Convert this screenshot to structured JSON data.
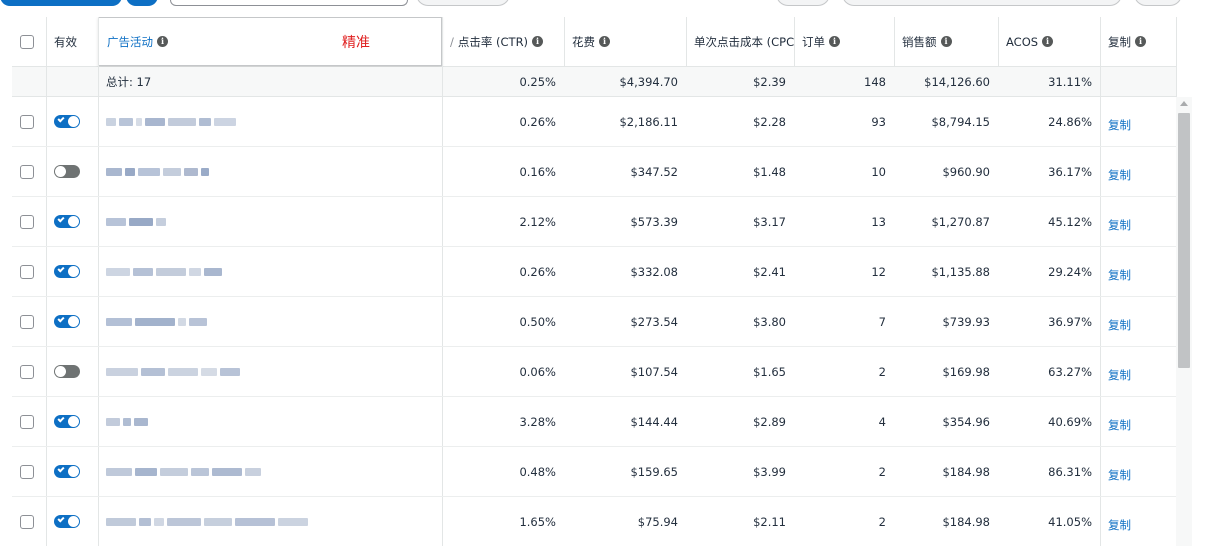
{
  "header": {
    "active": "有效",
    "campaign": "广告活动",
    "precise_tag": "精准",
    "ctr": "点击率 (CTR)",
    "ctr_prefix": "/",
    "spend": "花费",
    "cpc": "单次点击成本 (CPC)",
    "orders": "订单",
    "sales": "销售额",
    "acos": "ACOS",
    "copy": "复制"
  },
  "total": {
    "label": "总计: 17",
    "ctr": "0.25%",
    "spend": "$4,394.70",
    "cpc": "$2.39",
    "orders": "148",
    "sales": "$14,126.60",
    "acos": "31.11%"
  },
  "rows": [
    {
      "enabled": true,
      "ctr": "0.26%",
      "spend": "$2,186.11",
      "cpc": "$2.28",
      "orders": "93",
      "sales": "$8,794.15",
      "acos": "24.86%",
      "copy": "复制"
    },
    {
      "enabled": false,
      "ctr": "0.16%",
      "spend": "$347.52",
      "cpc": "$1.48",
      "orders": "10",
      "sales": "$960.90",
      "acos": "36.17%",
      "copy": "复制"
    },
    {
      "enabled": true,
      "ctr": "2.12%",
      "spend": "$573.39",
      "cpc": "$3.17",
      "orders": "13",
      "sales": "$1,270.87",
      "acos": "45.12%",
      "copy": "复制"
    },
    {
      "enabled": true,
      "ctr": "0.26%",
      "spend": "$332.08",
      "cpc": "$2.41",
      "orders": "12",
      "sales": "$1,135.88",
      "acos": "29.24%",
      "copy": "复制"
    },
    {
      "enabled": true,
      "ctr": "0.50%",
      "spend": "$273.54",
      "cpc": "$3.80",
      "orders": "7",
      "sales": "$739.93",
      "acos": "36.97%",
      "copy": "复制"
    },
    {
      "enabled": false,
      "ctr": "0.06%",
      "spend": "$107.54",
      "cpc": "$1.65",
      "orders": "2",
      "sales": "$169.98",
      "acos": "63.27%",
      "copy": "复制"
    },
    {
      "enabled": true,
      "ctr": "3.28%",
      "spend": "$144.44",
      "cpc": "$2.89",
      "orders": "4",
      "sales": "$354.96",
      "acos": "40.69%",
      "copy": "复制"
    },
    {
      "enabled": true,
      "ctr": "0.48%",
      "spend": "$159.65",
      "cpc": "$3.99",
      "orders": "2",
      "sales": "$184.98",
      "acos": "86.31%",
      "copy": "复制"
    },
    {
      "enabled": true,
      "ctr": "1.65%",
      "spend": "$75.94",
      "cpc": "$2.11",
      "orders": "2",
      "sales": "$184.98",
      "acos": "41.05%",
      "copy": "复制"
    }
  ],
  "icons": {
    "info": "info-circle-icon",
    "toggle_on": "toggle-on-icon",
    "toggle_off": "toggle-off-icon"
  },
  "colors": {
    "accent": "#0d6fc4",
    "precise_tag": "#e02020",
    "toggle_off": "#6f7373"
  }
}
